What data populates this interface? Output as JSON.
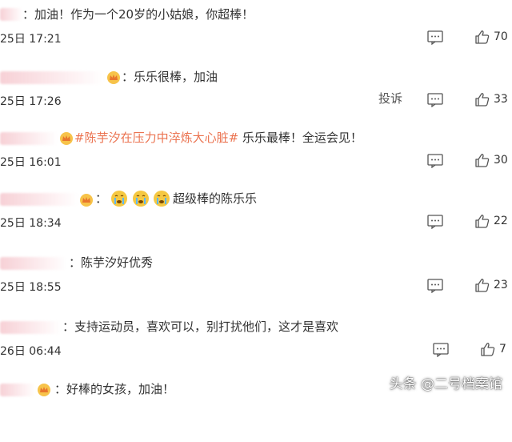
{
  "comments": [
    {
      "text": "：加油！作为一个20岁的小姑娘，你超棒！",
      "time": "25日 17:21",
      "likes": "70"
    },
    {
      "text": "：乐乐很棒，加油",
      "time": "25日 17:26",
      "report": "投诉",
      "likes": "33"
    },
    {
      "topic": "#陈芋汐在压力中淬炼大心脏#",
      "text": " 乐乐最棒！全运会见！",
      "time": "25日 16:01",
      "likes": "30"
    },
    {
      "text": "超级棒的陈乐乐",
      "time": "25日 18:34",
      "likes": "22"
    },
    {
      "text": "：陈芋汐好优秀",
      "time": "25日 18:55",
      "likes": "23"
    },
    {
      "text": "：支持运动员，喜欢可以，别打扰他们，这才是喜欢",
      "time": "26日 06:44",
      "likes": "7"
    },
    {
      "text": "：好棒的女孩，加油！",
      "time": "",
      "likes": ""
    }
  ],
  "watermark": "头条 @二号档案馆",
  "icons": {
    "reply": "comment-icon",
    "like": "thumbs-up-icon",
    "badge": "crown-badge-icon",
    "emoji": "crying-emoji-icon"
  },
  "colors": {
    "topic": "#eb7350",
    "text": "#333333"
  }
}
